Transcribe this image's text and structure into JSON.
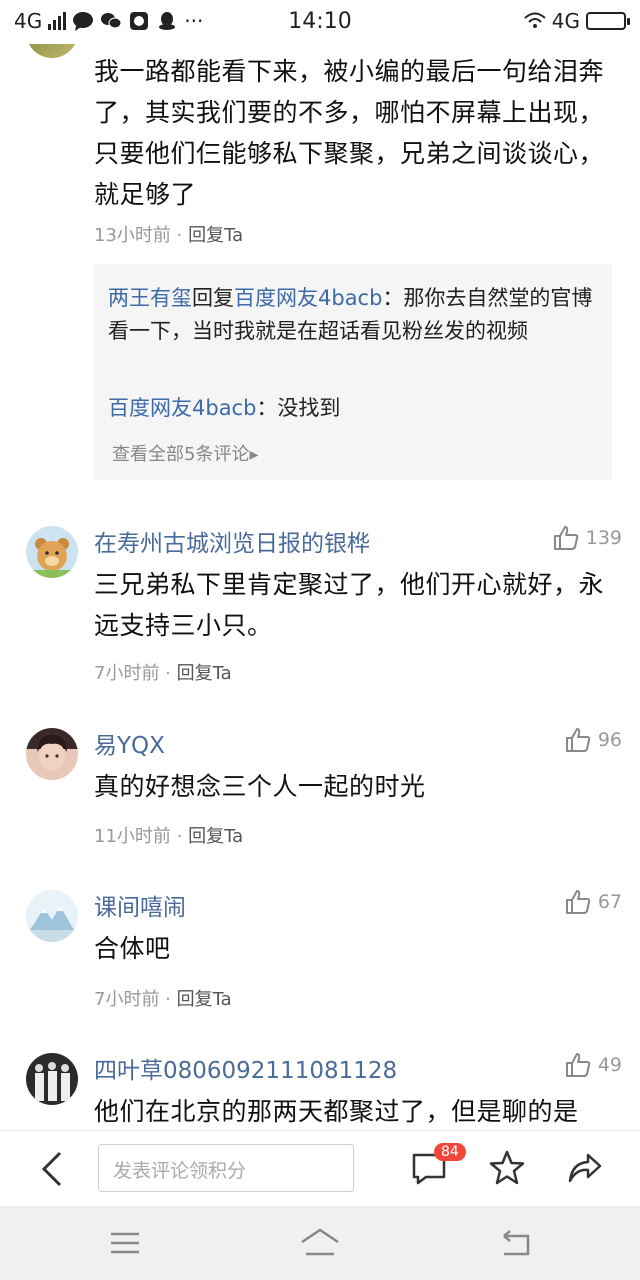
{
  "status": {
    "network_left": "4G",
    "time": "14:10",
    "network_right": "4G"
  },
  "comments": [
    {
      "text": "我一路都能看下来，被小编的最后一句给泪奔了，其实我们要的不多，哪怕不屏幕上出现，只要他们仨能够私下聚聚，兄弟之间谈谈心，就足够了",
      "time": "13小时前",
      "reply_label": "回复Ta",
      "replies": [
        {
          "user": "两王有玺",
          "verb": "回复",
          "target": "百度网友4bacb",
          "text": "：那你去自然堂的官博看一下，当时我就是在超话看见粉丝发的视频"
        },
        {
          "user": "百度网友4bacb",
          "text": "：没找到"
        }
      ],
      "view_all": "查看全部5条评论"
    },
    {
      "user": "在寿州古城浏览日报的银桦",
      "likes": "139",
      "text": "三兄弟私下里肯定聚过了，他们开心就好，永远支持三小只。",
      "time": "7小时前",
      "reply_label": "回复Ta"
    },
    {
      "user": "易YQX",
      "likes": "96",
      "text": "真的好想念三个人一起的时光",
      "time": "11小时前",
      "reply_label": "回复Ta"
    },
    {
      "user": "课间嘻闹",
      "likes": "67",
      "text": "合体吧",
      "time": "7小时前",
      "reply_label": "回复Ta"
    },
    {
      "user": "四叶草0806092111081128",
      "likes": "49",
      "text": "他们在北京的那两天都聚过了，但是聊的是"
    }
  ],
  "bottom_bar": {
    "input_placeholder": "发表评论领积分",
    "comment_count": "84"
  },
  "colors": {
    "link_blue": "#3d6aa6",
    "badge_red": "#f0473a",
    "reply_bg": "#f5f5f5"
  }
}
